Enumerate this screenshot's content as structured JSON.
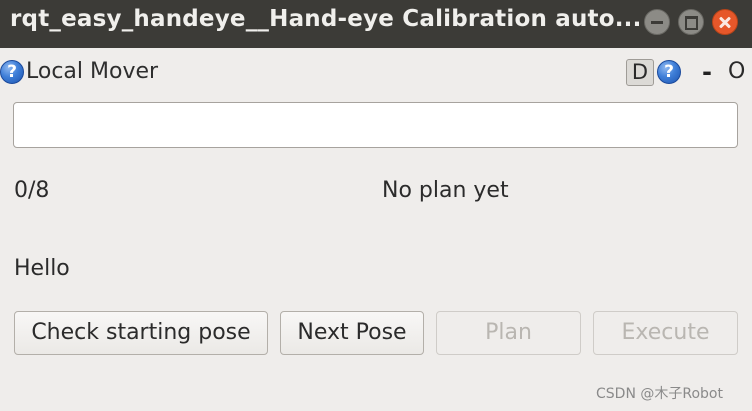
{
  "window": {
    "title": "rqt_easy_handeye__Hand-eye Calibration auto..."
  },
  "dock": {
    "help_left_glyph": "?",
    "title": "Local Mover",
    "d_label": "D",
    "help_right_glyph": "?",
    "dash_label": "-",
    "o_label": "O"
  },
  "main": {
    "input_value": "",
    "progress": "0/8",
    "plan_status": "No plan yet",
    "message": "Hello"
  },
  "buttons": {
    "check_starting_pose": "Check starting pose",
    "next_pose": "Next Pose",
    "plan": "Plan",
    "execute": "Execute"
  },
  "watermark": "CSDN @木子Robot",
  "colors": {
    "titlebar": "#3c3b37",
    "close_button": "#e6572a",
    "help_icon": "#3f7fd8",
    "window_bg": "#efedeb"
  },
  "icons": {
    "help": "help-icon",
    "minimize": "minimize-icon",
    "maximize": "maximize-icon",
    "close": "close-icon"
  }
}
